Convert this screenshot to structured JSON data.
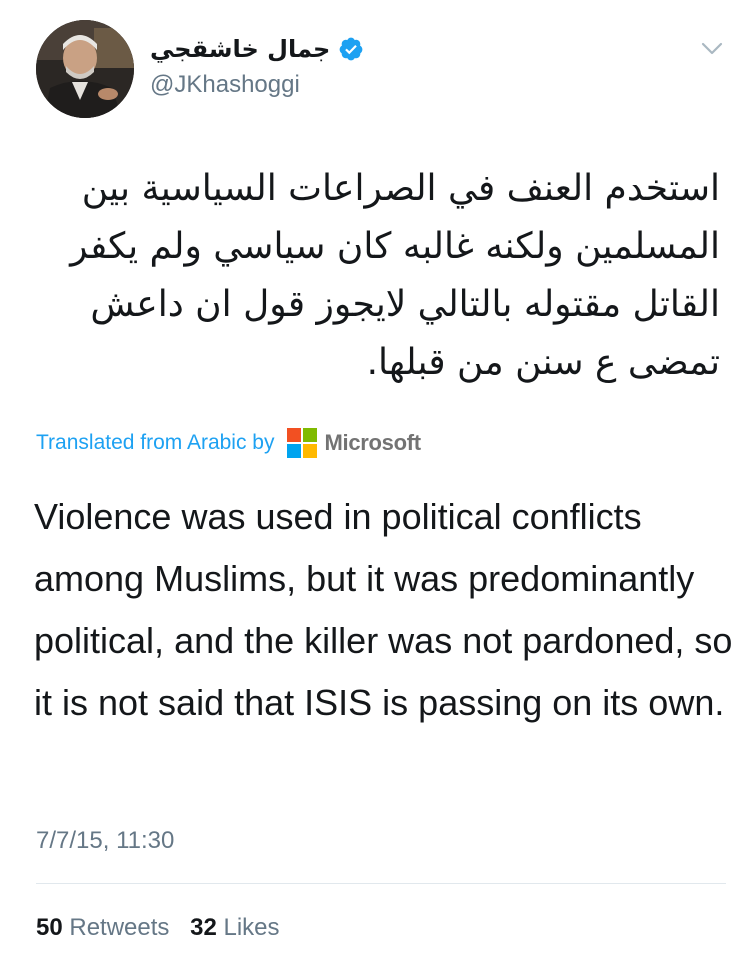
{
  "author": {
    "display_name": "جمال خاشقجي",
    "handle": "@JKhashoggi",
    "verified": true
  },
  "icons": {
    "avatar": "profile-photo",
    "verified": "verified-badge-icon",
    "menu": "chevron-down-icon",
    "translator": "microsoft-logo"
  },
  "tweet": {
    "original_text": "استخدم العنف في الصراعات السياسية بين المسلمين ولكنه غالبه كان سياسي ولم يكفر القاتل مقتوله بالتالي لايجوز قول ان داعش تمضى ع سنن من قبلها.",
    "translated_prefix": "Translated from Arabic by",
    "translator_name": "Microsoft",
    "translated_text": "Violence was used in political conflicts among Muslims, but it was predominantly political, and the killer was not pardoned, so it is not said that ISIS is passing on its own.",
    "timestamp": "7/7/15, 11:30"
  },
  "stats": {
    "retweets_count": "50",
    "retweets_label": "Retweets",
    "likes_count": "32",
    "likes_label": "Likes"
  },
  "colors": {
    "link": "#1da1f2",
    "verified": "#1da1f2",
    "secondary_text": "#657786",
    "divider": "#e1e8ed",
    "ms_red": "#f25022",
    "ms_green": "#7fba00",
    "ms_blue": "#00a4ef",
    "ms_yellow": "#ffb900"
  }
}
